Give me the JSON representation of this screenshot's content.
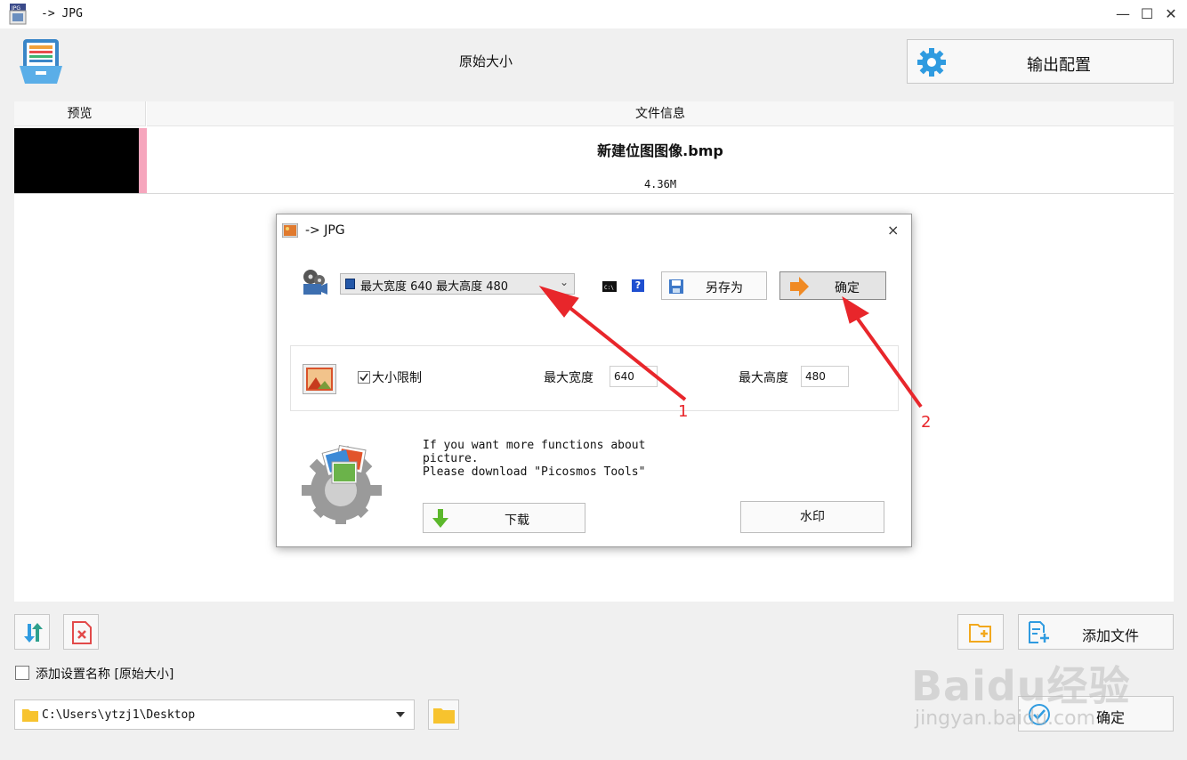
{
  "window": {
    "title": "-> JPG",
    "controls": {
      "minimize": "—",
      "maximize": "☐",
      "close": "✕"
    }
  },
  "header": {
    "preset_label": "原始大小",
    "output_config_label": "输出配置"
  },
  "file_list": {
    "columns": [
      "预览",
      "文件信息"
    ],
    "rows": [
      {
        "name": "新建位图图像.bmp",
        "size": "4.36M"
      }
    ]
  },
  "dialog": {
    "title": "-> JPG",
    "close": "×",
    "preset_select": "最大宽度 640 最大高度 480",
    "save_as_label": "另存为",
    "ok_label": "确定",
    "size_limit_label": "大小限制",
    "size_limit_checked": true,
    "max_width_label": "最大宽度",
    "max_width_value": "640",
    "max_height_label": "最大高度",
    "max_height_value": "480",
    "promo_line1": "If you want more functions about",
    "promo_line2": "picture.",
    "promo_line3": "Please download \"Picosmos Tools\"",
    "download_label": "下载",
    "watermark_label": "水印"
  },
  "annotations": {
    "arrow1": "1",
    "arrow2": "2",
    "color": "#e8262b"
  },
  "bottom": {
    "add_name_label": "添加设置名称 [原始大小]",
    "output_path": "C:\\Users\\ytzj1\\Desktop",
    "add_file_label": "添加文件",
    "confirm_label": "确定"
  },
  "watermark": {
    "brand": "Baidu经验",
    "url": "jingyan.baidu.com"
  },
  "colors": {
    "accent": "#2f9be0",
    "folder": "#f7c32e",
    "pink": "#f6a6bd",
    "red": "#e8262b"
  }
}
